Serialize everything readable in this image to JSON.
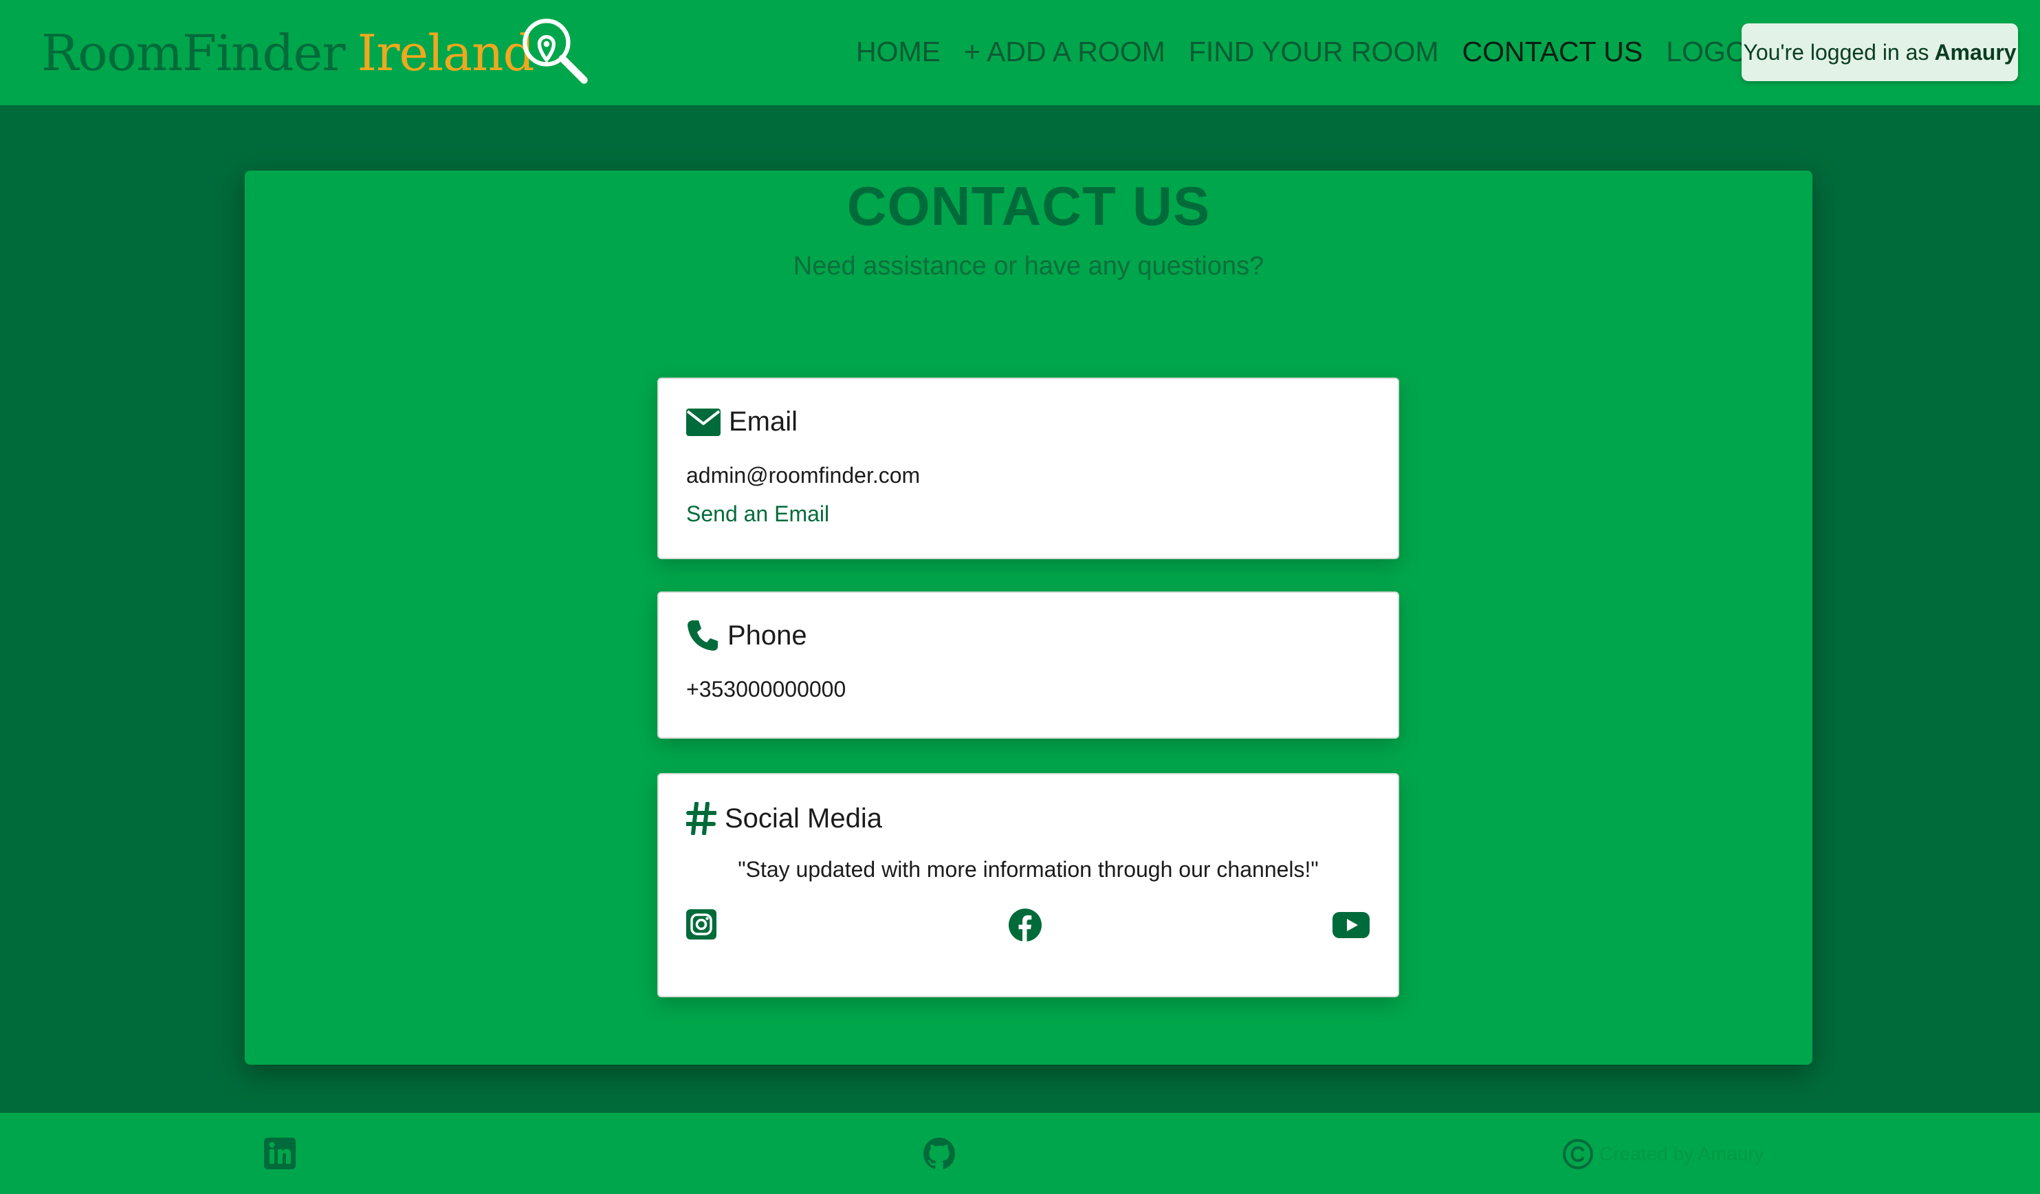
{
  "brand": {
    "part1": "RoomFinder",
    "part2": "Ireland",
    "logo_icon": "location-search-icon"
  },
  "nav": {
    "items": [
      {
        "label": "HOME",
        "active": false
      },
      {
        "label": "+ ADD A ROOM",
        "active": false
      },
      {
        "label": "FIND YOUR ROOM",
        "active": false
      },
      {
        "label": "CONTACT US",
        "active": true
      },
      {
        "label": "LOGOUT",
        "active": false
      }
    ],
    "login_prefix": "You're logged in as",
    "login_user": "Amaury"
  },
  "page": {
    "title": "CONTACT US",
    "subtitle": "Need assistance or have any questions?"
  },
  "cards": {
    "email": {
      "icon": "envelope-icon",
      "title": "Email",
      "address": "admin@roomfinder.com",
      "link_label": "Send an Email"
    },
    "phone": {
      "icon": "phone-icon",
      "title": "Phone",
      "number": "+353000000000"
    },
    "social": {
      "icon": "hashtag-icon",
      "title": "Social Media",
      "quote": "\"Stay updated with more information through our channels!\"",
      "icons": [
        "instagram-icon",
        "facebook-icon",
        "youtube-icon"
      ]
    }
  },
  "footer": {
    "icons": [
      "linkedin-icon",
      "github-icon",
      "copyright-icon"
    ],
    "credit": "Created by Amaury"
  },
  "colors": {
    "primary": "#00a64b",
    "dark": "#006b3a",
    "accent": "#f0a81e"
  }
}
